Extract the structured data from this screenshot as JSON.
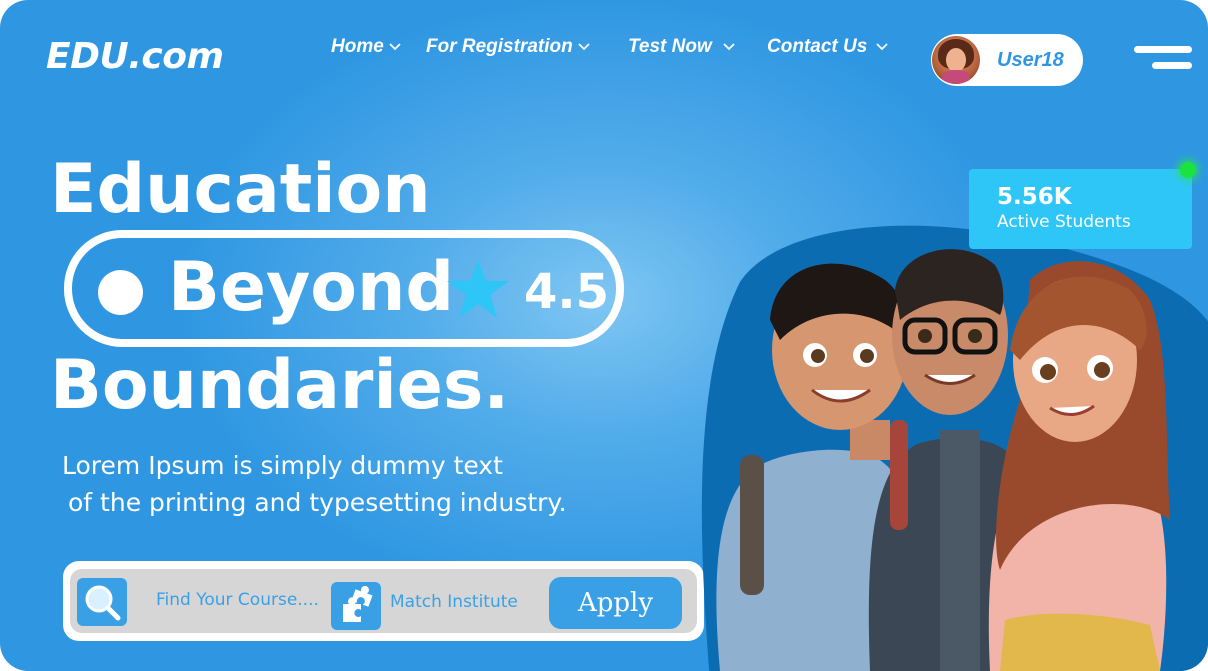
{
  "header": {
    "logo": "EDU.com",
    "nav": [
      {
        "label": "Home"
      },
      {
        "label": "For Registration"
      },
      {
        "label": "Test Now"
      },
      {
        "label": "Contact Us"
      }
    ],
    "user": {
      "name": "User18"
    },
    "menu_icon": "hamburger-menu-icon"
  },
  "hero": {
    "line1": "Education",
    "line2": "Beyond",
    "rating": "4.5",
    "rating_icon": "star-icon",
    "line3": "Boundaries.",
    "subtitle_line1": "Lorem Ipsum is simply dummy text",
    "subtitle_line2": "of the printing and typesetting industry."
  },
  "search": {
    "course_placeholder": "Find Your Course....",
    "course_icon": "search-icon",
    "institute_label": "Match Institute",
    "institute_icon": "puzzle-icon",
    "apply_label": "Apply"
  },
  "stats": {
    "value": "5.56K",
    "label": "Active Students",
    "status_color": "#19e33c"
  },
  "colors": {
    "background": "#2f97e2",
    "accent": "#3aa0e6",
    "stats_card": "#2ec6f7",
    "blob": "#0c6cb2"
  }
}
